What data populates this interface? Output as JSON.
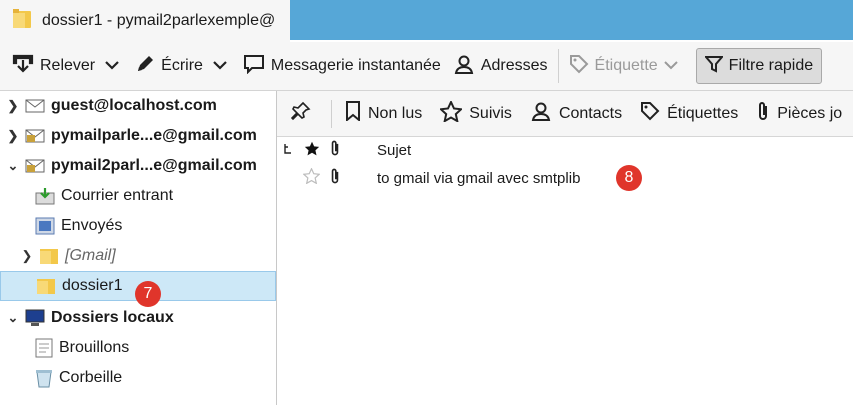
{
  "tab": {
    "title": "dossier1 - pymail2parlexemple@"
  },
  "toolbar": {
    "get_mail": "Relever",
    "write": "Écrire",
    "chat": "Messagerie instantanée",
    "address_book": "Adresses",
    "tag": "Étiquette",
    "quick_filter": "Filtre rapide"
  },
  "folders": [
    {
      "label": "guest@localhost.com",
      "bold": true
    },
    {
      "label": "pymailparle...e@gmail.com",
      "bold": true
    },
    {
      "label": "pymail2parl...e@gmail.com",
      "bold": true
    },
    {
      "label": "Courrier entrant"
    },
    {
      "label": "Envoyés"
    },
    {
      "label": "[Gmail]"
    },
    {
      "label": "dossier1",
      "selected": true
    },
    {
      "label": "Dossiers locaux",
      "bold": true
    },
    {
      "label": "Brouillons"
    },
    {
      "label": "Corbeille"
    }
  ],
  "quick_filter_bar": {
    "unread": "Non lus",
    "starred": "Suivis",
    "contacts": "Contacts",
    "tags": "Étiquettes",
    "attachments": "Pièces jo"
  },
  "thread_pane": {
    "columns": {
      "subject": "Sujet"
    },
    "messages": [
      {
        "subject": "to gmail via gmail avec smtplib"
      }
    ]
  },
  "annotations": {
    "folder_badge": "7",
    "message_badge": "8"
  },
  "colors": {
    "tabbar": "#56a7d7",
    "selected_row": "#cde8f7",
    "badge": "#e0352b"
  }
}
